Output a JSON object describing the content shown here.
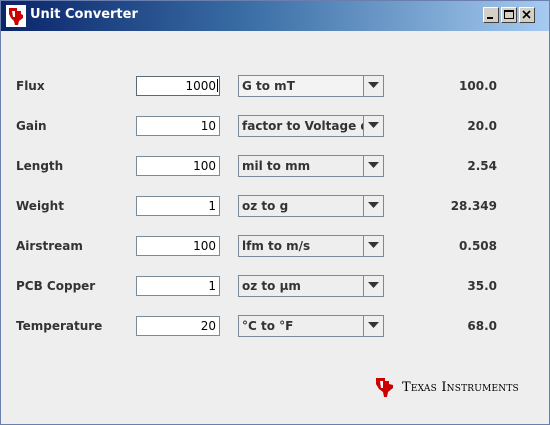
{
  "window": {
    "title": "Unit Converter"
  },
  "rows": [
    {
      "label": "Flux",
      "value": "1000",
      "selected": "G to mT",
      "result": "100.0"
    },
    {
      "label": "Gain",
      "value": "10",
      "selected": "factor to Voltage dB",
      "result": "20.0"
    },
    {
      "label": "Length",
      "value": "100",
      "selected": "mil to mm",
      "result": "2.54"
    },
    {
      "label": "Weight",
      "value": "1",
      "selected": "oz to g",
      "result": "28.349"
    },
    {
      "label": "Airstream",
      "value": "100",
      "selected": "lfm to m/s",
      "result": "0.508"
    },
    {
      "label": "PCB Copper",
      "value": "1",
      "selected": "oz to µm",
      "result": "35.0"
    },
    {
      "label": "Temperature",
      "value": "20",
      "selected": "°C to °F",
      "result": "68.0"
    }
  ],
  "brand": {
    "name": "Texas Instruments",
    "logo_icon": "ti-logo-icon",
    "logo_color": "#cc0000"
  },
  "colors": {
    "titlebar_start": "#0a246a",
    "titlebar_end": "#a6caf0",
    "window_bg": "#eeeeee"
  }
}
